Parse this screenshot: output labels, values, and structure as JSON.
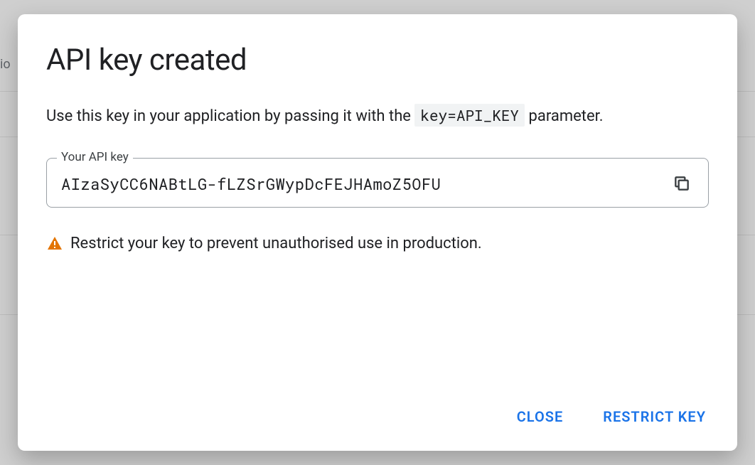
{
  "dialog": {
    "title": "API key created",
    "description_pre": "Use this key in your application by passing it with the ",
    "description_code": "key=API_KEY",
    "description_post": " parameter.",
    "key_field_label": "Your API key",
    "api_key": "AIzaSyCC6NABtLG-fLZSrGWypDcFEJHAmoZ5OFU",
    "warning_text": "Restrict your key to prevent unauthorised use in production.",
    "actions": {
      "close": "CLOSE",
      "restrict": "RESTRICT KEY"
    }
  },
  "icons": {
    "copy": "copy-icon",
    "warning": "warning-icon"
  },
  "background_fragment": "io"
}
